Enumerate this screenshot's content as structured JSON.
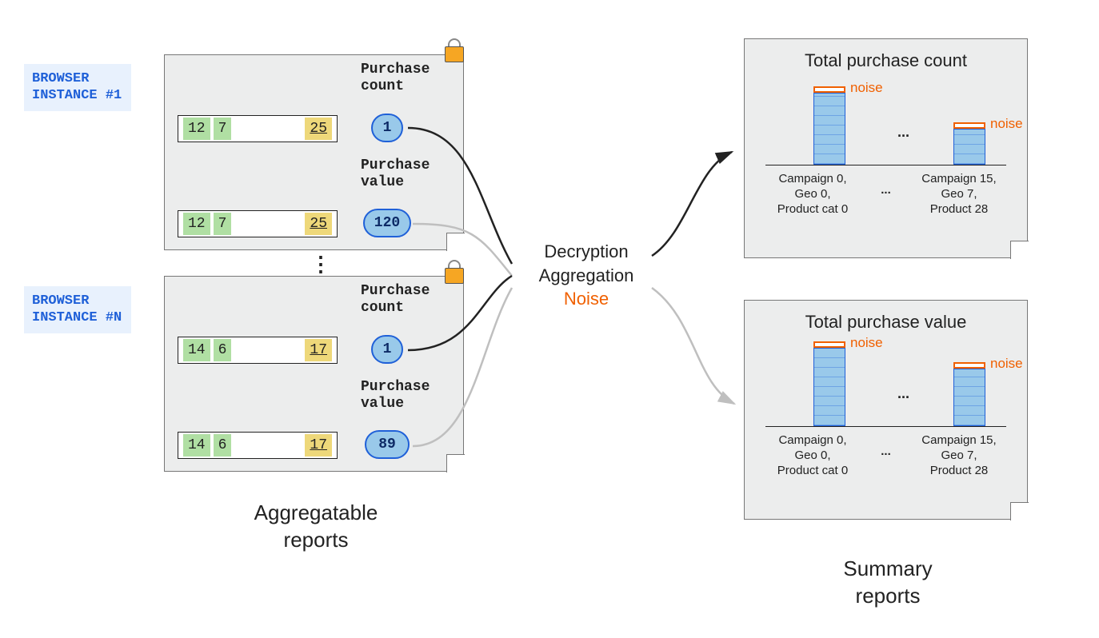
{
  "browsers": {
    "b1": {
      "line1": "BROWSER",
      "line2": "INSTANCE #1"
    },
    "bn": {
      "line1": "BROWSER",
      "line2": "INSTANCE #N"
    }
  },
  "reports": {
    "r1": {
      "key_a": "12",
      "key_b": "7",
      "key_c": "25",
      "count_label": "Purchase\ncount",
      "count_value": "1",
      "value_label": "Purchase\nvalue",
      "value_value": "120"
    },
    "rn": {
      "key_a": "14",
      "key_b": "6",
      "key_c": "17",
      "count_label": "Purchase\ncount",
      "count_value": "1",
      "value_label": "Purchase\nvalue",
      "value_value": "89"
    }
  },
  "middle": {
    "line1": "Decryption",
    "line2": "Aggregation",
    "line3": "Noise"
  },
  "summaries": {
    "count": {
      "title": "Total purchase count",
      "noise_label": "noise",
      "ellipsis": "...",
      "axis_left": "Campaign 0,\nGeo 0,\nProduct cat 0",
      "axis_mid": "...",
      "axis_right": "Campaign 15,\nGeo 7,\nProduct 28"
    },
    "value": {
      "title": "Total purchase value",
      "noise_label": "noise",
      "ellipsis": "...",
      "axis_left": "Campaign 0,\nGeo 0,\nProduct cat 0",
      "axis_mid": "...",
      "axis_right": "Campaign 15,\nGeo 7,\nProduct 28"
    }
  },
  "chart_data": [
    {
      "type": "bar",
      "title": "Total purchase count",
      "categories": [
        "Campaign 0, Geo 0, Product cat 0",
        "Campaign 15, Geo 7, Product 28"
      ],
      "values": [
        90,
        45
      ],
      "noise": [
        8,
        8
      ],
      "ylim": [
        0,
        100
      ],
      "note": "heights are relative; original chart has no y-axis ticks"
    },
    {
      "type": "bar",
      "title": "Total purchase value",
      "categories": [
        "Campaign 0, Geo 0, Product cat 0",
        "Campaign 15, Geo 7, Product 28"
      ],
      "values": [
        95,
        70
      ],
      "noise": [
        8,
        8
      ],
      "ylim": [
        0,
        100
      ],
      "note": "heights are relative; original chart has no y-axis ticks"
    }
  ],
  "labels": {
    "left_section": "Aggregatable\nreports",
    "right_section": "Summary\nreports",
    "vellipsis": "⋮"
  }
}
